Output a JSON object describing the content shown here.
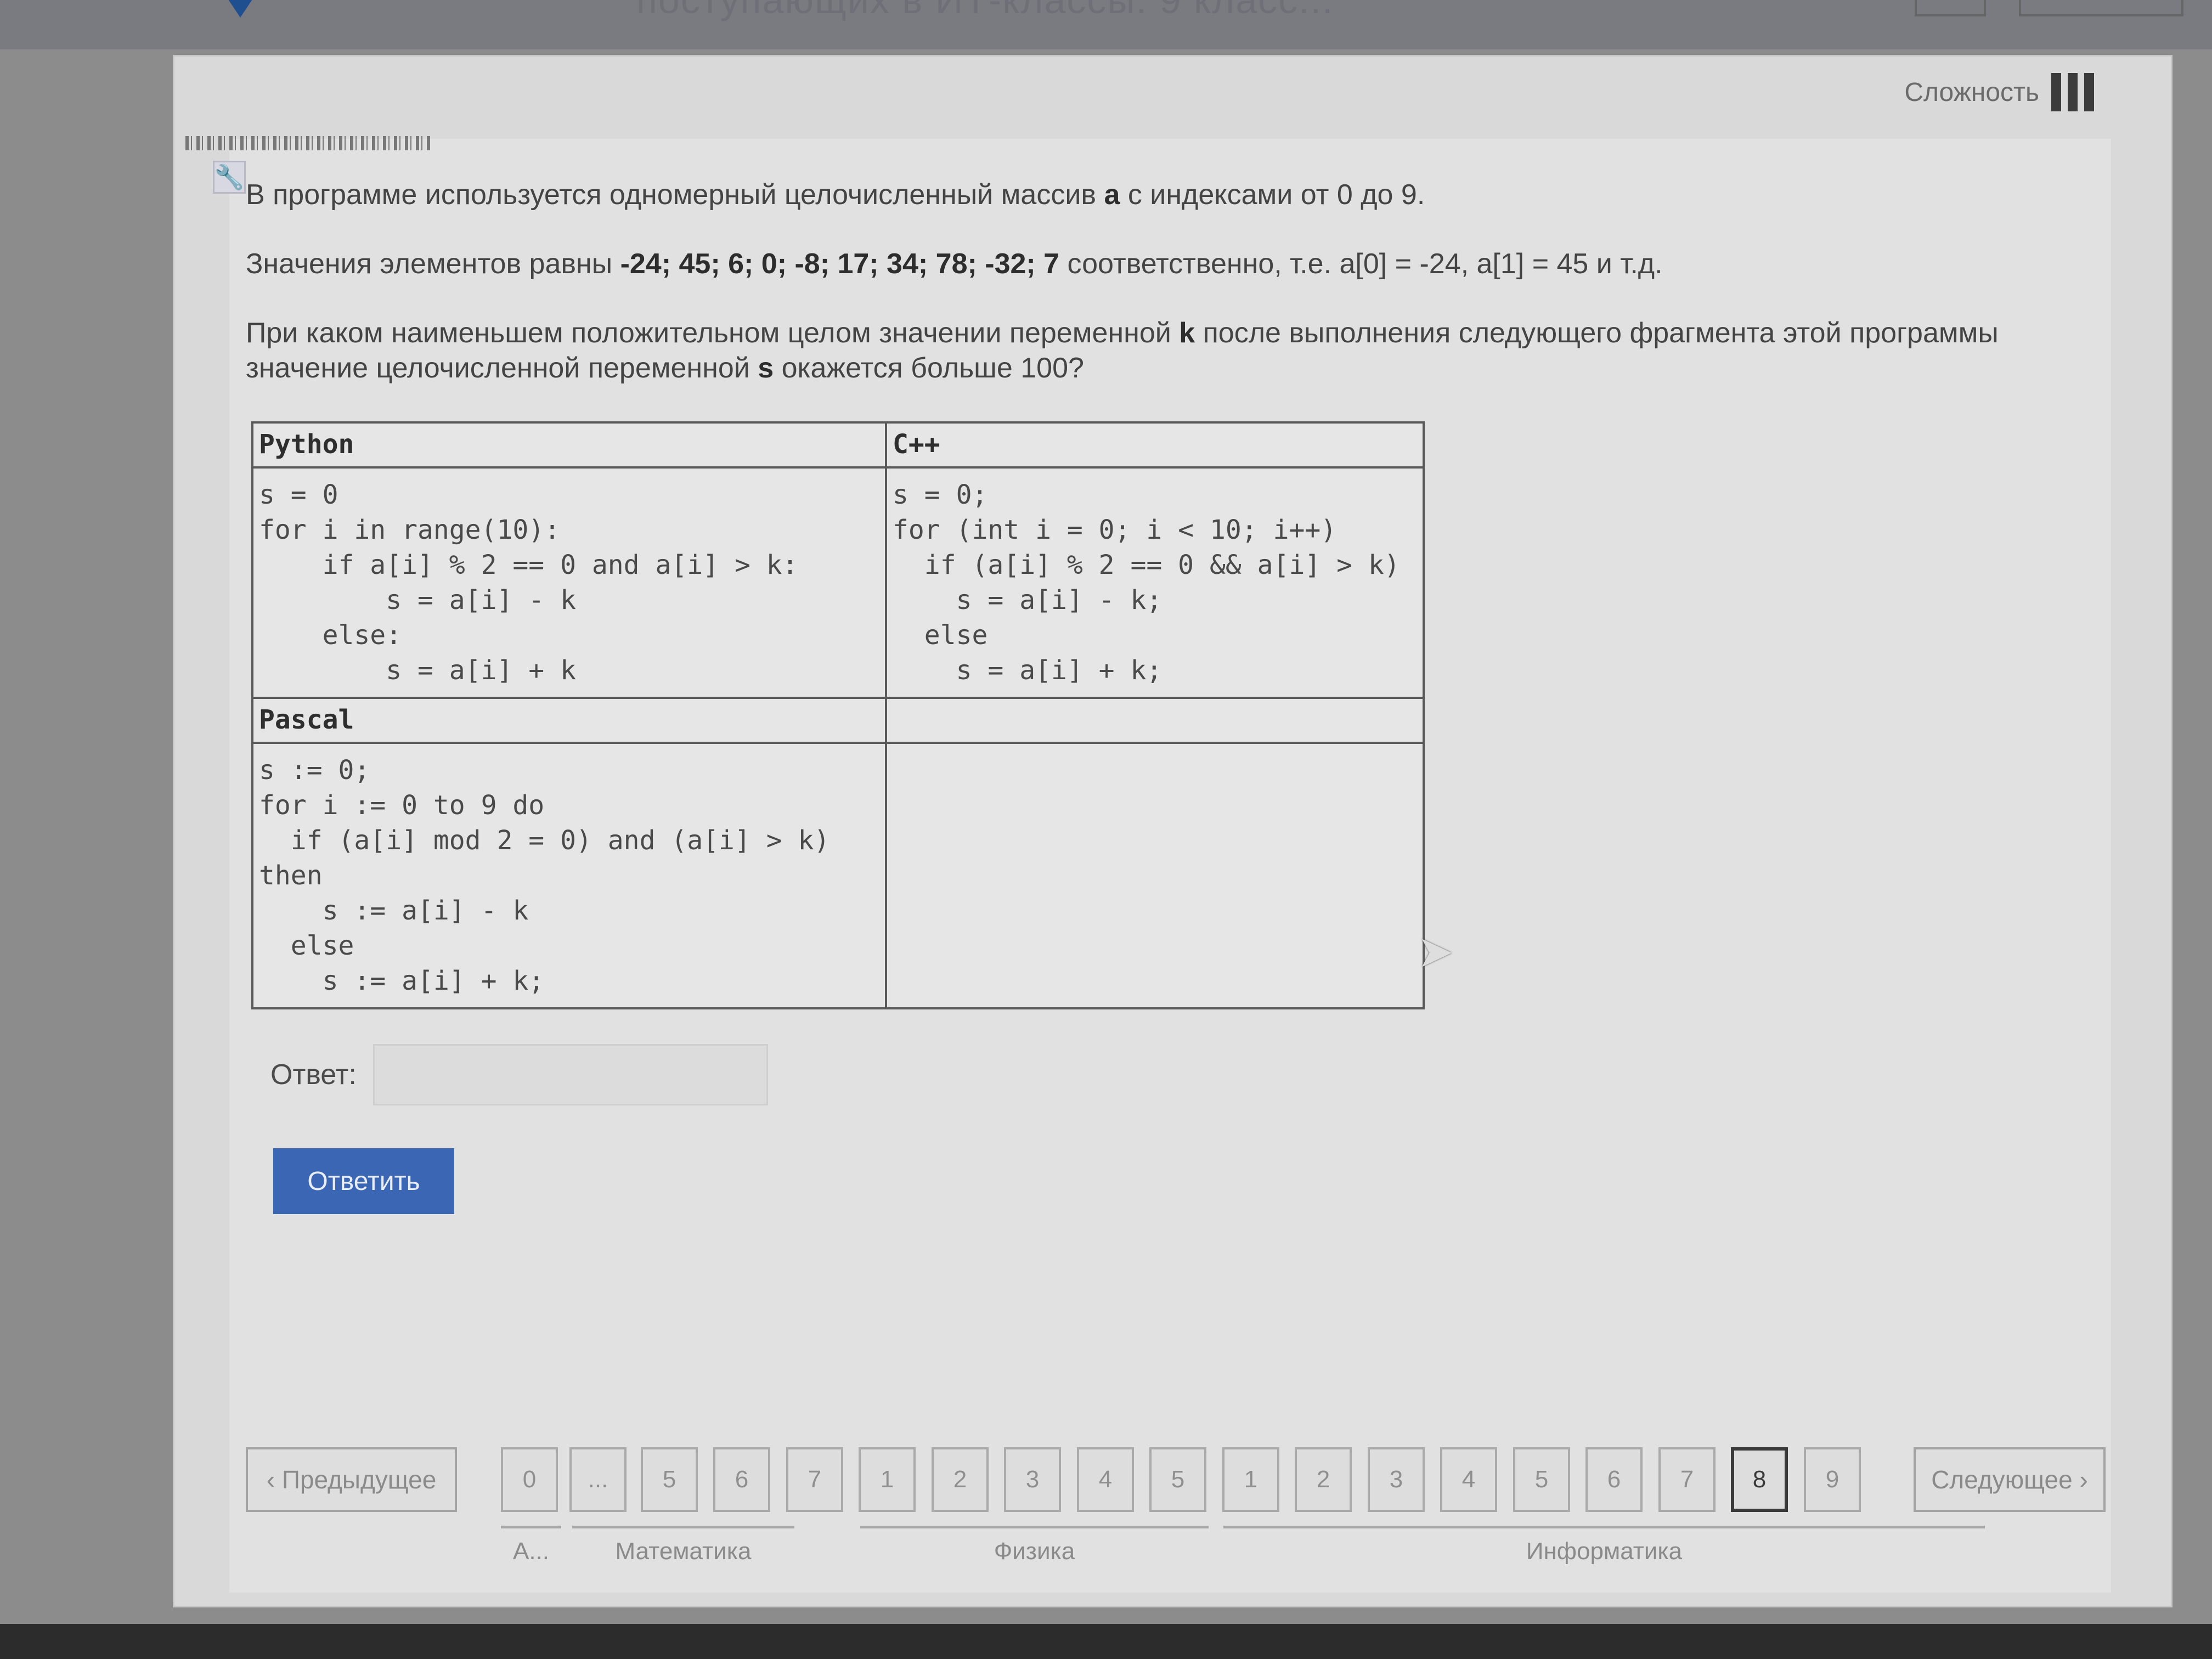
{
  "page_title": "поступающих в ИТ-классы. 9 класс...",
  "difficulty": {
    "label": "Сложность"
  },
  "problem": {
    "p1_a": "В программе используется одномерный целочисленный массив ",
    "p1_b": "a",
    "p1_c": " с индексами от 0 до 9.",
    "p2_a": "Значения элементов равны ",
    "p2_b": "-24; 45; 6; 0; -8; 17; 34; 78; -32; 7",
    "p2_c": " соответственно, т.е. a[0] = -24, a[1] = 45 и т.д.",
    "p3_a": "При каком наименьшем положительном целом значении переменной ",
    "p3_b": "k",
    "p3_c": " после выполнения следующего фрагмента этой программы значение целочисленной переменной ",
    "p3_d": "s",
    "p3_e": " окажется больше 100?"
  },
  "code_table": {
    "python_header": "Python",
    "cpp_header": "C++",
    "pascal_header": "Pascal",
    "python_code": "s = 0\nfor i in range(10):\n    if a[i] % 2 == 0 and a[i] > k:\n        s = a[i] - k\n    else:\n        s = a[i] + k",
    "cpp_code": "s = 0;\nfor (int i = 0; i < 10; i++)\n  if (a[i] % 2 == 0 && a[i] > k)\n    s = a[i] - k;\n  else\n    s = a[i] + k;",
    "pascal_code": "s := 0;\nfor i := 0 to 9 do\n  if (a[i] mod 2 = 0) and (a[i] > k)\nthen\n    s := a[i] - k\n  else\n    s := a[i] + k;"
  },
  "answer": {
    "label": "Ответ:",
    "value": "",
    "placeholder": ""
  },
  "submit_label": "Ответить",
  "pager": {
    "prev_label": "‹ Предыдущее",
    "next_label": "Следующее ›",
    "items": [
      "0",
      "...",
      "5",
      "6",
      "7",
      "1",
      "2",
      "3",
      "4",
      "5",
      "1",
      "2",
      "3",
      "4",
      "5",
      "6",
      "7",
      "8",
      "9"
    ],
    "current_index": 17,
    "groups": [
      "А...",
      "Математика",
      "Физика",
      "Информатика"
    ]
  },
  "colors": {
    "accent": "#3a66b3",
    "background": "#d9d9d9"
  }
}
